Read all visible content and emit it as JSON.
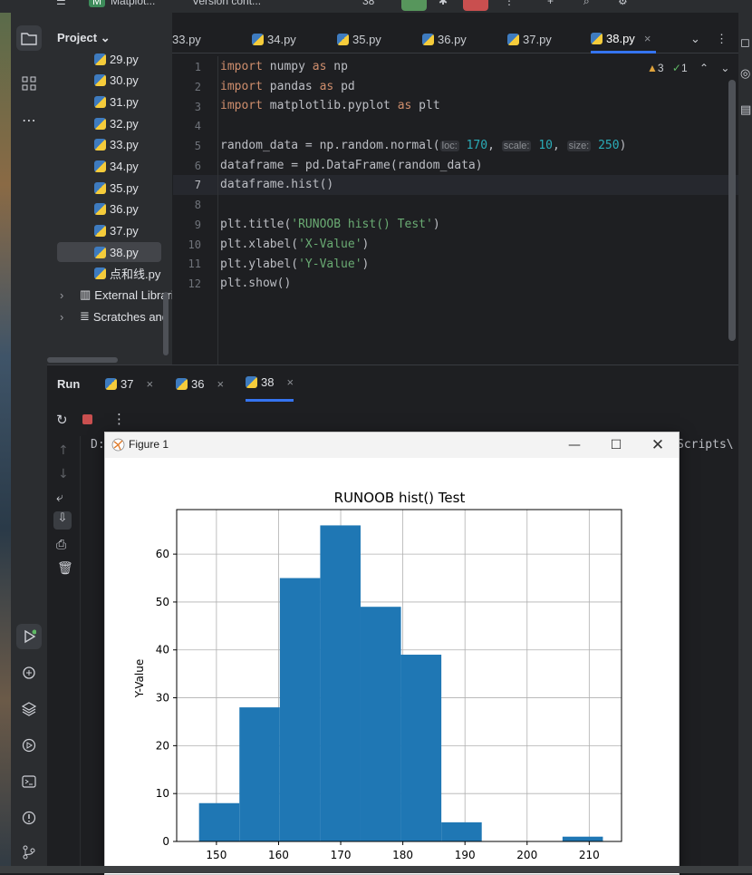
{
  "titlebar": {
    "app_badge": "M",
    "project_name": "Matplot...",
    "vcs": "Version cont...",
    "run_config": "38"
  },
  "project_panel": {
    "header": "Project",
    "files": [
      "29.py",
      "30.py",
      "31.py",
      "32.py",
      "33.py",
      "34.py",
      "35.py",
      "36.py",
      "37.py",
      "38.py",
      "点和线.py"
    ],
    "selected": "38.py",
    "external_libraries": "External Librari",
    "scratches": "Scratches and C"
  },
  "editor_tabs": [
    "33.py",
    "34.py",
    "35.py",
    "36.py",
    "37.py",
    "38.py"
  ],
  "active_tab": "38.py",
  "inspections": {
    "warnings": "3",
    "checks": "1"
  },
  "code_lines": {
    "l1_kw": "import",
    "l1_mod": "numpy",
    "l1_as": "as",
    "l1_alias": "np",
    "l2_kw": "import",
    "l2_mod": "pandas",
    "l2_as": "as",
    "l2_alias": "pd",
    "l3_kw": "import",
    "l3_mod": "matplotlib.pyplot",
    "l3_as": "as",
    "l3_alias": "plt",
    "l5_pre": "random_data = np.random.normal(",
    "l5_h1": "loc:",
    "l5_v1": "170",
    "l5_h2": "scale:",
    "l5_v2": "10",
    "l5_h3": "size:",
    "l5_v3": "250",
    "l5_post": ")",
    "l6": "dataframe = pd.DataFrame(random_data)",
    "l7": "dataframe.hist()",
    "l9_pre": "plt.title(",
    "l9_str": "'RUNOOB hist() Test'",
    "l9_post": ")",
    "l10_pre": "plt.xlabel(",
    "l10_str": "'X-Value'",
    "l10_post": ")",
    "l11_pre": "plt.ylabel(",
    "l11_str": "'Y-Value'",
    "l11_post": ")",
    "l12": "plt.show()"
  },
  "line_numbers": [
    "1",
    "2",
    "3",
    "4",
    "5",
    "6",
    "7",
    "8",
    "9",
    "10",
    "11",
    "12"
  ],
  "run_panel": {
    "label": "Run",
    "tabs": [
      "37",
      "36",
      "38"
    ],
    "active_tab": "38",
    "console_left": "D:",
    "console_right": "Scripts\\"
  },
  "figure_window": {
    "title": "Figure 1"
  },
  "chart_data": {
    "type": "bar",
    "title": "RUNOOB hist() Test",
    "ylabel": "Y-Value",
    "xlabel": "",
    "bin_edges": [
      147.2,
      153.7,
      160.2,
      166.7,
      173.2,
      179.7,
      186.2,
      192.7,
      199.2,
      205.7,
      212.2
    ],
    "values": [
      8,
      28,
      55,
      66,
      49,
      39,
      4,
      0,
      0,
      1
    ],
    "xlim": [
      143.6,
      215.2
    ],
    "ylim": [
      0,
      69.3
    ],
    "xticks": [
      150,
      160,
      170,
      180,
      190,
      200,
      210
    ],
    "yticks": [
      0,
      10,
      20,
      30,
      40,
      50,
      60
    ],
    "bar_color": "#1f77b4",
    "grid": true
  }
}
